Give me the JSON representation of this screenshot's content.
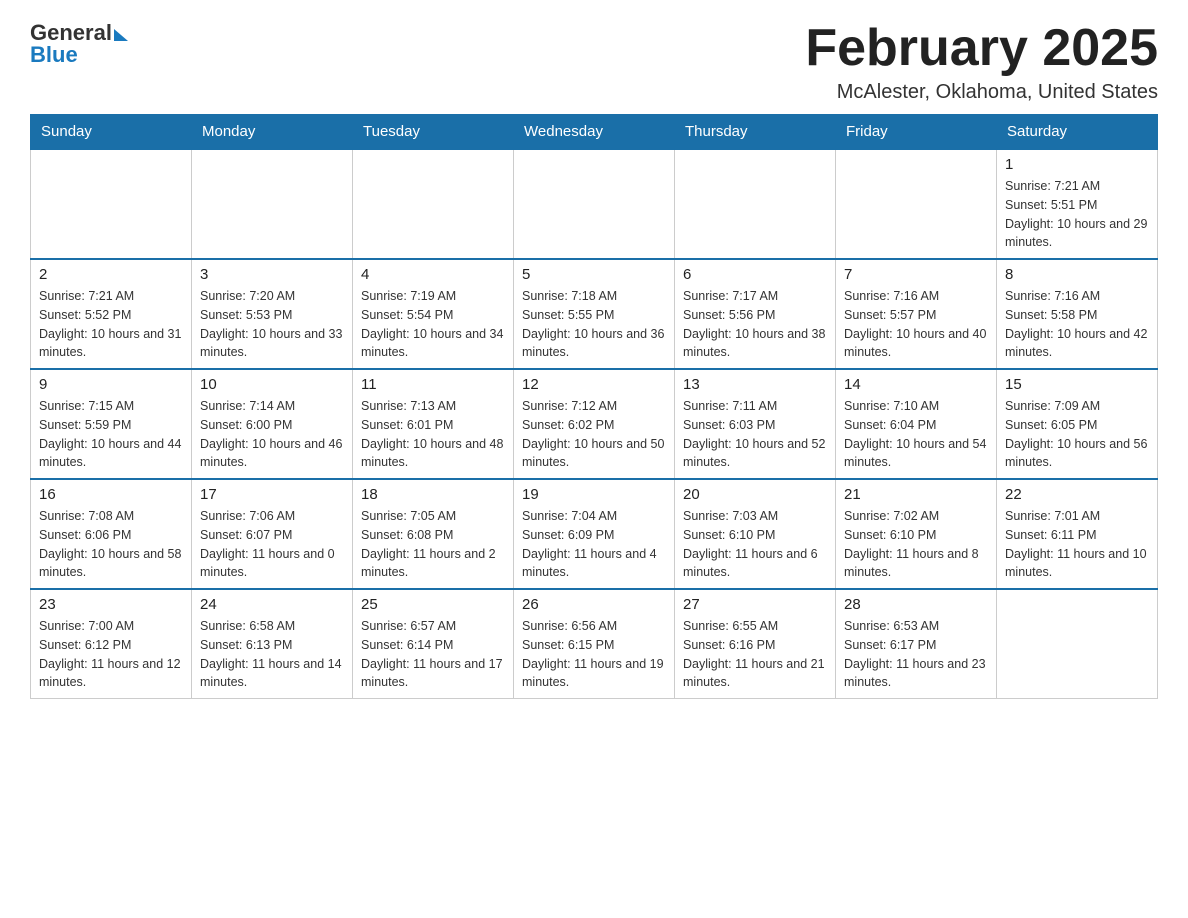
{
  "logo": {
    "general": "General",
    "blue": "Blue"
  },
  "title": "February 2025",
  "location": "McAlester, Oklahoma, United States",
  "days_of_week": [
    "Sunday",
    "Monday",
    "Tuesday",
    "Wednesday",
    "Thursday",
    "Friday",
    "Saturday"
  ],
  "weeks": [
    [
      {
        "day": "",
        "sunrise": "",
        "sunset": "",
        "daylight": ""
      },
      {
        "day": "",
        "sunrise": "",
        "sunset": "",
        "daylight": ""
      },
      {
        "day": "",
        "sunrise": "",
        "sunset": "",
        "daylight": ""
      },
      {
        "day": "",
        "sunrise": "",
        "sunset": "",
        "daylight": ""
      },
      {
        "day": "",
        "sunrise": "",
        "sunset": "",
        "daylight": ""
      },
      {
        "day": "",
        "sunrise": "",
        "sunset": "",
        "daylight": ""
      },
      {
        "day": "1",
        "sunrise": "Sunrise: 7:21 AM",
        "sunset": "Sunset: 5:51 PM",
        "daylight": "Daylight: 10 hours and 29 minutes."
      }
    ],
    [
      {
        "day": "2",
        "sunrise": "Sunrise: 7:21 AM",
        "sunset": "Sunset: 5:52 PM",
        "daylight": "Daylight: 10 hours and 31 minutes."
      },
      {
        "day": "3",
        "sunrise": "Sunrise: 7:20 AM",
        "sunset": "Sunset: 5:53 PM",
        "daylight": "Daylight: 10 hours and 33 minutes."
      },
      {
        "day": "4",
        "sunrise": "Sunrise: 7:19 AM",
        "sunset": "Sunset: 5:54 PM",
        "daylight": "Daylight: 10 hours and 34 minutes."
      },
      {
        "day": "5",
        "sunrise": "Sunrise: 7:18 AM",
        "sunset": "Sunset: 5:55 PM",
        "daylight": "Daylight: 10 hours and 36 minutes."
      },
      {
        "day": "6",
        "sunrise": "Sunrise: 7:17 AM",
        "sunset": "Sunset: 5:56 PM",
        "daylight": "Daylight: 10 hours and 38 minutes."
      },
      {
        "day": "7",
        "sunrise": "Sunrise: 7:16 AM",
        "sunset": "Sunset: 5:57 PM",
        "daylight": "Daylight: 10 hours and 40 minutes."
      },
      {
        "day": "8",
        "sunrise": "Sunrise: 7:16 AM",
        "sunset": "Sunset: 5:58 PM",
        "daylight": "Daylight: 10 hours and 42 minutes."
      }
    ],
    [
      {
        "day": "9",
        "sunrise": "Sunrise: 7:15 AM",
        "sunset": "Sunset: 5:59 PM",
        "daylight": "Daylight: 10 hours and 44 minutes."
      },
      {
        "day": "10",
        "sunrise": "Sunrise: 7:14 AM",
        "sunset": "Sunset: 6:00 PM",
        "daylight": "Daylight: 10 hours and 46 minutes."
      },
      {
        "day": "11",
        "sunrise": "Sunrise: 7:13 AM",
        "sunset": "Sunset: 6:01 PM",
        "daylight": "Daylight: 10 hours and 48 minutes."
      },
      {
        "day": "12",
        "sunrise": "Sunrise: 7:12 AM",
        "sunset": "Sunset: 6:02 PM",
        "daylight": "Daylight: 10 hours and 50 minutes."
      },
      {
        "day": "13",
        "sunrise": "Sunrise: 7:11 AM",
        "sunset": "Sunset: 6:03 PM",
        "daylight": "Daylight: 10 hours and 52 minutes."
      },
      {
        "day": "14",
        "sunrise": "Sunrise: 7:10 AM",
        "sunset": "Sunset: 6:04 PM",
        "daylight": "Daylight: 10 hours and 54 minutes."
      },
      {
        "day": "15",
        "sunrise": "Sunrise: 7:09 AM",
        "sunset": "Sunset: 6:05 PM",
        "daylight": "Daylight: 10 hours and 56 minutes."
      }
    ],
    [
      {
        "day": "16",
        "sunrise": "Sunrise: 7:08 AM",
        "sunset": "Sunset: 6:06 PM",
        "daylight": "Daylight: 10 hours and 58 minutes."
      },
      {
        "day": "17",
        "sunrise": "Sunrise: 7:06 AM",
        "sunset": "Sunset: 6:07 PM",
        "daylight": "Daylight: 11 hours and 0 minutes."
      },
      {
        "day": "18",
        "sunrise": "Sunrise: 7:05 AM",
        "sunset": "Sunset: 6:08 PM",
        "daylight": "Daylight: 11 hours and 2 minutes."
      },
      {
        "day": "19",
        "sunrise": "Sunrise: 7:04 AM",
        "sunset": "Sunset: 6:09 PM",
        "daylight": "Daylight: 11 hours and 4 minutes."
      },
      {
        "day": "20",
        "sunrise": "Sunrise: 7:03 AM",
        "sunset": "Sunset: 6:10 PM",
        "daylight": "Daylight: 11 hours and 6 minutes."
      },
      {
        "day": "21",
        "sunrise": "Sunrise: 7:02 AM",
        "sunset": "Sunset: 6:10 PM",
        "daylight": "Daylight: 11 hours and 8 minutes."
      },
      {
        "day": "22",
        "sunrise": "Sunrise: 7:01 AM",
        "sunset": "Sunset: 6:11 PM",
        "daylight": "Daylight: 11 hours and 10 minutes."
      }
    ],
    [
      {
        "day": "23",
        "sunrise": "Sunrise: 7:00 AM",
        "sunset": "Sunset: 6:12 PM",
        "daylight": "Daylight: 11 hours and 12 minutes."
      },
      {
        "day": "24",
        "sunrise": "Sunrise: 6:58 AM",
        "sunset": "Sunset: 6:13 PM",
        "daylight": "Daylight: 11 hours and 14 minutes."
      },
      {
        "day": "25",
        "sunrise": "Sunrise: 6:57 AM",
        "sunset": "Sunset: 6:14 PM",
        "daylight": "Daylight: 11 hours and 17 minutes."
      },
      {
        "day": "26",
        "sunrise": "Sunrise: 6:56 AM",
        "sunset": "Sunset: 6:15 PM",
        "daylight": "Daylight: 11 hours and 19 minutes."
      },
      {
        "day": "27",
        "sunrise": "Sunrise: 6:55 AM",
        "sunset": "Sunset: 6:16 PM",
        "daylight": "Daylight: 11 hours and 21 minutes."
      },
      {
        "day": "28",
        "sunrise": "Sunrise: 6:53 AM",
        "sunset": "Sunset: 6:17 PM",
        "daylight": "Daylight: 11 hours and 23 minutes."
      },
      {
        "day": "",
        "sunrise": "",
        "sunset": "",
        "daylight": ""
      }
    ]
  ]
}
